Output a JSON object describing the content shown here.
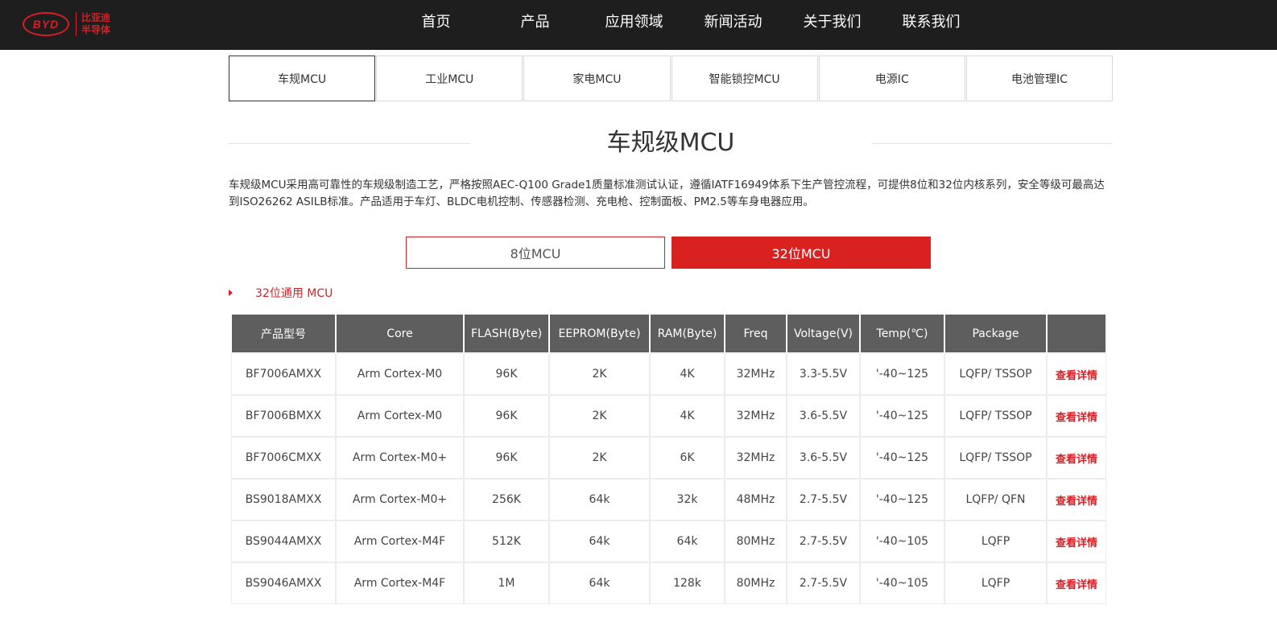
{
  "logo": {
    "mark": "BYD",
    "text_line1": "比亚迪",
    "text_line2": "半导体"
  },
  "nav": [
    "首页",
    "产品",
    "应用领域",
    "新闻活动",
    "关于我们",
    "联系我们"
  ],
  "category_tabs": [
    "车规MCU",
    "工业MCU",
    "家电MCU",
    "智能锁控MCU",
    "电源IC",
    "电池管理IC"
  ],
  "active_category": "车规MCU",
  "section": {
    "title": "车规级MCU",
    "description": "车规级MCU采用高可靠性的车规级制造工艺，严格按照AEC-Q100 Grade1质量标准测试认证，遵循IATF16949体系下生产管控流程，可提供8位和32位内核系列，安全等级可最高达到ISO26262 ASILB标准。产品适用于车灯、BLDC电机控制、传感器检测、充电枪、控制面板、PM2.5等车身电器应用。"
  },
  "bit_toggle": {
    "option_8": "8位MCU",
    "option_32": "32位MCU",
    "active": "32位MCU"
  },
  "series_label": "32位通用 MCU",
  "table": {
    "headers": [
      "产品型号",
      "Core",
      "FLASH(Byte)",
      "EEPROM(Byte)",
      "RAM(Byte)",
      "Freq",
      "Voltage(V)",
      "Temp(℃)",
      "Package",
      ""
    ],
    "rows": [
      [
        "BF7006AMXX",
        "Arm Cortex-M0",
        "96K",
        "2K",
        "4K",
        "32MHz",
        "3.3-5.5V",
        "'-40~125",
        "LQFP/ TSSOP",
        "查看详情"
      ],
      [
        "BF7006BMXX",
        "Arm Cortex-M0",
        "96K",
        "2K",
        "4K",
        "32MHz",
        "3.6-5.5V",
        "'-40~125",
        "LQFP/ TSSOP",
        "查看详情"
      ],
      [
        "BF7006CMXX",
        "Arm Cortex-M0+",
        "96K",
        "2K",
        "6K",
        "32MHz",
        "3.6-5.5V",
        "'-40~125",
        "LQFP/ TSSOP",
        "查看详情"
      ],
      [
        "BS9018AMXX",
        "Arm Cortex-M0+",
        "256K",
        "64k",
        "32k",
        "48MHz",
        "2.7-5.5V",
        "'-40~125",
        "LQFP/ QFN",
        "查看详情"
      ],
      [
        "BS9044AMXX",
        "Arm Cortex-M4F",
        "512K",
        "64k",
        "64k",
        "80MHz",
        "2.7-5.5V",
        "'-40~105",
        "LQFP",
        "查看详情"
      ],
      [
        "BS9046AMXX",
        "Arm Cortex-M4F",
        "1M",
        "64k",
        "128k",
        "80MHz",
        "2.7-5.5V",
        "'-40~105",
        "LQFP",
        "查看详情"
      ]
    ]
  },
  "colors": {
    "accent": "#d9211f",
    "header_bg": "#1e1e1e",
    "table_header_bg": "#5e5e5e"
  }
}
